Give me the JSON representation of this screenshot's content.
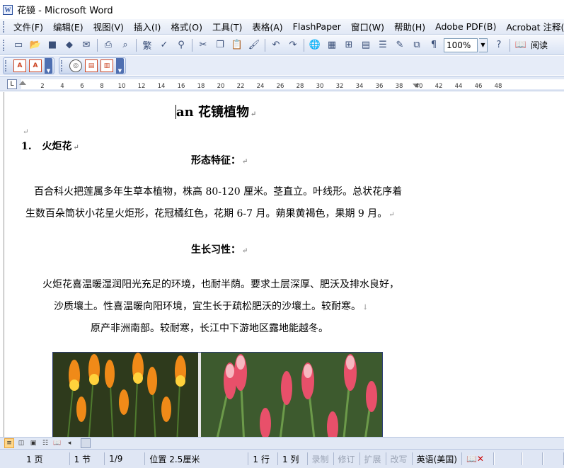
{
  "window": {
    "title": "花镜 - Microsoft Word",
    "app_icon": "word-document-icon"
  },
  "menu": {
    "items": [
      "文件(F)",
      "编辑(E)",
      "视图(V)",
      "插入(I)",
      "格式(O)",
      "工具(T)",
      "表格(A)",
      "FlashPaper",
      "窗口(W)",
      "帮助(H)",
      "Adobe PDF(B)",
      "Acrobat 注释(C)"
    ]
  },
  "toolbar": {
    "zoom_value": "100%",
    "read_label": "阅读",
    "font_glyph": "繁"
  },
  "ruler": {
    "ticks": [
      "2",
      "4",
      "6",
      "8",
      "10",
      "12",
      "14",
      "16",
      "18",
      "20",
      "22",
      "24",
      "26",
      "28",
      "30",
      "32",
      "34",
      "36",
      "38",
      "40",
      "42",
      "44",
      "46",
      "48"
    ],
    "corner": "L"
  },
  "document": {
    "title": "an 花镜植物",
    "item1_number": "1.",
    "item1_title": "火炬花",
    "heading_morph": "形态特征：",
    "morph_line1": "百合科火把莲属多年生草本植物，株高 80-120 厘米。茎直立。叶线形。总状花序着",
    "morph_line2": "生数百朵筒状小花呈火炬形，花冠橘红色，花期 6-7 月。蒴果黄褐色，果期 9 月。",
    "heading_habit": "生长习性：",
    "habit_line1": "火炬花喜温暖湿润阳光充足的环境，也耐半荫。要求土层深厚、肥沃及排水良好，",
    "habit_line2": "沙质壤土。性喜温暖向阳环境，宜生长于疏松肥沃的沙壤土。较耐寒。",
    "habit_line3": "原产非洲南部。较耐寒，长江中下游地区露地能越冬。",
    "para_mark": "↵",
    "line_break_mark": "↓"
  },
  "status": {
    "page": "1 页",
    "section": "1 节",
    "page_of": "1/9",
    "position": "位置 2.5厘米",
    "line": "1 行",
    "column": "1 列",
    "rec": "录制",
    "trk": "修订",
    "ext": "扩展",
    "ovr": "改写",
    "language": "英语(美国)"
  }
}
